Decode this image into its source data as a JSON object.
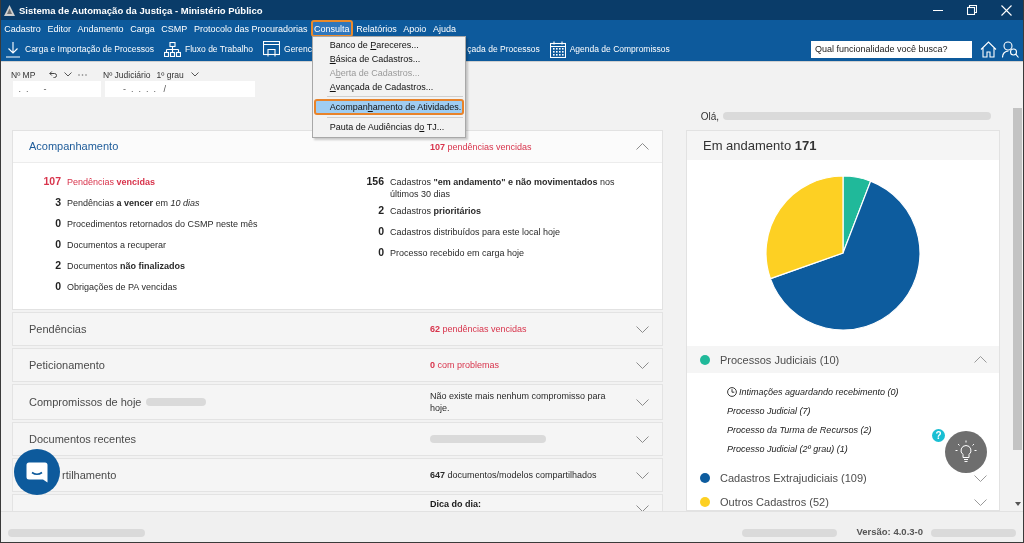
{
  "window": {
    "title": "Sistema de Automação da Justiça - Ministério Público"
  },
  "menu_bar": [
    {
      "label": "Cadastro",
      "selected": false,
      "highlighted": false
    },
    {
      "label": "Editor",
      "selected": false,
      "highlighted": false
    },
    {
      "label": "Andamento",
      "selected": false,
      "highlighted": false
    },
    {
      "label": "Carga",
      "selected": false,
      "highlighted": false
    },
    {
      "label": "CSMP",
      "selected": false,
      "highlighted": false
    },
    {
      "label": "Protocolo das Procuradorias",
      "selected": false,
      "highlighted": false
    },
    {
      "label": "Consulta",
      "selected": true,
      "highlighted": true
    },
    {
      "label": "Relatórios",
      "selected": false,
      "highlighted": false
    },
    {
      "label": "Apoio",
      "selected": false,
      "highlighted": false
    },
    {
      "label": "Ajuda",
      "selected": false,
      "highlighted": false
    }
  ],
  "dropdown_menu": [
    {
      "kind": "item",
      "text_before": "Banco de ",
      "access_key": "P",
      "text_after": "areceres...",
      "disabled": false,
      "selected": false,
      "highlighted": false
    },
    {
      "kind": "item",
      "access_key": "B",
      "text_after": "ásica de Cadastros...",
      "disabled": false,
      "selected": false,
      "highlighted": false
    },
    {
      "kind": "item",
      "text_before": "A",
      "access_key": "b",
      "text_after": "erta de Cadastros...",
      "disabled": true,
      "selected": false,
      "highlighted": false
    },
    {
      "kind": "item",
      "access_key": "A",
      "text_after": "vançada de Cadastros...",
      "disabled": false,
      "selected": false,
      "highlighted": false
    },
    {
      "kind": "separator"
    },
    {
      "kind": "item",
      "text_before": "Acompan",
      "access_key": "h",
      "text_after": "amento de Atividades.",
      "disabled": false,
      "selected": true,
      "highlighted": true
    },
    {
      "kind": "separator"
    },
    {
      "kind": "item",
      "text_before": "Pauta de Audiências d",
      "access_key": "o",
      "text_after": " TJ...",
      "disabled": false,
      "selected": false,
      "highlighted": false
    }
  ],
  "toolbar": {
    "items": [
      {
        "kind": "import",
        "label": "Carga e Importação de Processos"
      },
      {
        "kind": "workflow",
        "label": "Fluxo de Trabalho"
      },
      {
        "kind": "manager",
        "label": "Gerenci"
      },
      {
        "kind": "covered",
        "label": "çada de Processos"
      },
      {
        "kind": "agenda",
        "label": "Agenda de Compromissos"
      }
    ],
    "search": {
      "placeholder": "Qual funcionalidade você busca?"
    }
  },
  "fields": [
    {
      "kind": "history",
      "label": "Nº MP",
      "value": " .  .      -"
    },
    {
      "kind": "degree",
      "label": "Nº Judiciário",
      "option": "1º grau",
      "value": "      -  .  .  .  .   /"
    }
  ],
  "greeting": [
    {
      "kind": "text",
      "text": "Olá,"
    },
    {
      "kind": "blurred"
    }
  ],
  "left_panel": {
    "sections": [
      {
        "title": "Acompanhamento",
        "title_blur": false,
        "cut_at_start": false,
        "expanded": true,
        "summary": {
          "kind": "alert",
          "text": "**107** pendências vencidas"
        },
        "columns": [
          [
            {
              "count": "107",
              "text": "Pendências **vencidas**",
              "alert": true
            },
            {
              "count": "3",
              "text": "Pendências **a vencer** em *10 dias*",
              "alert": false
            },
            {
              "count": "0",
              "text": "Procedimentos retornados do CSMP neste mês",
              "alert": false
            },
            {
              "count": "0",
              "text": "Documentos a recuperar",
              "alert": false
            },
            {
              "count": "2",
              "text": "Documentos **não finalizados**",
              "alert": false
            },
            {
              "count": "0",
              "text": "Obrigações de PA vencidas",
              "alert": false
            }
          ],
          [
            {
              "count": "156",
              "text": "Cadastros **\"em andamento\" e não movimentados** nos últimos 30 dias",
              "alert": false
            },
            {
              "count": "2",
              "text": "Cadastros **prioritários**",
              "alert": false
            },
            {
              "count": "0",
              "text": "Cadastros distribuídos para este local hoje",
              "alert": false
            },
            {
              "count": "0",
              "text": "Processo recebido em carga hoje",
              "alert": false
            }
          ]
        ]
      },
      {
        "title": "Pendências",
        "title_blur": false,
        "cut_at_start": false,
        "expanded": false,
        "summary": {
          "kind": "alert",
          "text": "**62** pendências vencidas"
        }
      },
      {
        "title": "Peticionamento",
        "title_blur": false,
        "cut_at_start": false,
        "expanded": false,
        "summary": {
          "kind": "alert",
          "text": "**0** com problemas"
        }
      },
      {
        "title": "Compromissos de hoje",
        "title_blur": true,
        "cut_at_start": false,
        "expanded": false,
        "summary": {
          "kind": "text",
          "text": "Não existe mais nenhum compromisso para hoje."
        }
      },
      {
        "title": "Documentos recentes",
        "title_blur": false,
        "cut_at_start": false,
        "expanded": false,
        "summary": {
          "kind": "blurred"
        }
      },
      {
        "title": "rtilhamento",
        "title_blur": false,
        "cut_at_start": true,
        "expanded": false,
        "summary": {
          "kind": "text",
          "text": "**647** documentos/modelos compartilhados"
        }
      },
      {
        "title_blur": false,
        "expanded": false,
        "summary": {
          "kind": "heading",
          "text": "Dica do dia:"
        }
      }
    ]
  },
  "right_panel": {
    "title": "Em andamento **171**",
    "chart_data": {
      "type": "pie",
      "categories": [
        "Processos Judiciais (10)",
        "Cadastros Extrajudiciais (109)",
        "Outros Cadastros (52)"
      ],
      "values": [
        10,
        109,
        52
      ]
    },
    "groups": [
      {
        "color": "#20b99a",
        "expanded": true,
        "items": [
          {
            "kind": "notice",
            "text": "Intimações aguardando recebimento (0)"
          },
          {
            "kind": "entry",
            "text": "Processo Judicial (7)"
          },
          {
            "kind": "entry",
            "text": "Processo da Turma de Recursos (2)"
          },
          {
            "kind": "entry",
            "text": "Processo Judicial (2º grau) (1)"
          }
        ]
      },
      {
        "color": "#0d5c9e",
        "expanded": false
      },
      {
        "color": "#fdd023",
        "expanded": false
      }
    ]
  },
  "tip_button": {
    "badge": "?"
  },
  "status_bar": [
    {
      "kind": "blurred"
    },
    {
      "kind": "blurred"
    },
    {
      "kind": "text",
      "text": "Versão: 4.0.3-0"
    },
    {
      "kind": "blurred"
    }
  ]
}
